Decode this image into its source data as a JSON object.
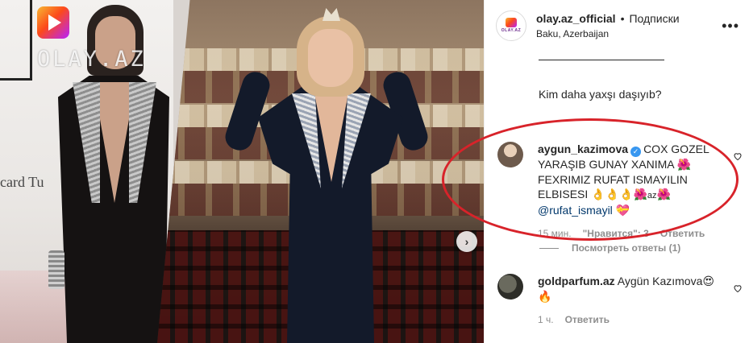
{
  "watermark": {
    "brand": "OLAY.AZ"
  },
  "photo": {
    "sponsor_text": "card Tu"
  },
  "header": {
    "username": "olay.az_official",
    "separator": "•",
    "follow_label": "Подписки",
    "location": "Baku, Azerbaijan",
    "avatar_text": "OLAY.AZ",
    "more_icon": "more-options-icon"
  },
  "caption": {
    "question": "Kim daha yaxşı daşıyıb?"
  },
  "comments": [
    {
      "username": "aygun_kazimova",
      "verified": true,
      "text_1": "COX GOZEL YARAŞIB GUNAY XANIMA",
      "emoji_1": "🌺",
      "text_2": "FEXRIMIZ RUFAT ISMAYILIN ELBISESI",
      "emoji_row": "👌👌👌🌺",
      "az_text": "az",
      "emoji_2": "🌺",
      "mention": "@rufat_ismayil",
      "emoji_3": "💝",
      "time": "15 мин.",
      "likes": "\"Нравится\": 3",
      "reply": "Ответить",
      "view_replies": "Посмотреть ответы (1)"
    },
    {
      "username": "goldparfum.az",
      "verified": false,
      "text": "Aygün Kazımova",
      "emoji_1": "😍",
      "emoji_2": "🔥",
      "time": "1 ч.",
      "reply": "Ответить"
    }
  ],
  "colors": {
    "highlight": "#d8232a",
    "verified": "#3897f0",
    "meta": "#8e8e8e",
    "mention": "#00376b"
  }
}
